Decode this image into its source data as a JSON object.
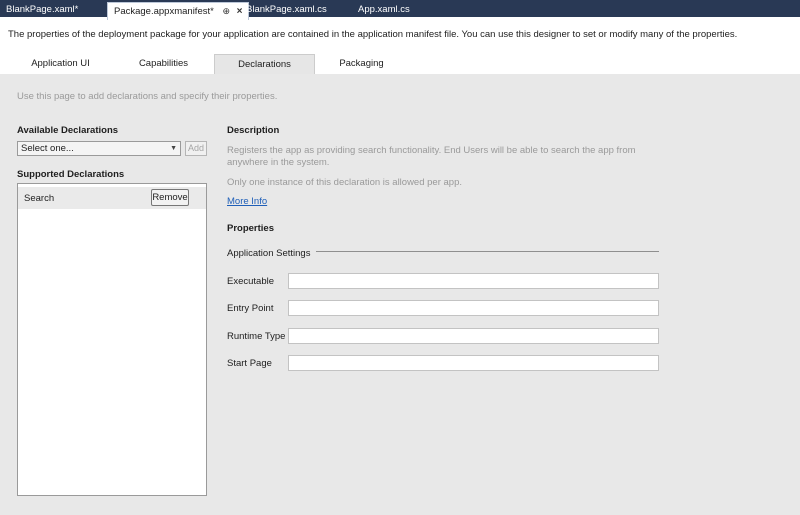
{
  "doc_tabs": [
    {
      "label": "BlankPage.xaml*"
    },
    {
      "label": "Package.appxmanifest*",
      "pin_glyph": "⊕",
      "close_glyph": "×"
    },
    {
      "label": "BlankPage.xaml.cs"
    },
    {
      "label": "App.xaml.cs"
    }
  ],
  "description": "The properties of the deployment package for your application are contained in the application manifest file. You can use this designer to set or modify many of the properties.",
  "designer_tabs": [
    {
      "label": "Application UI"
    },
    {
      "label": "Capabilities"
    },
    {
      "label": "Declarations"
    },
    {
      "label": "Packaging"
    }
  ],
  "hint": "Use this page to add declarations and specify their properties.",
  "available": {
    "title": "Available Declarations",
    "selected": "Select one...",
    "add_label": "Add"
  },
  "supported": {
    "title": "Supported Declarations",
    "items": [
      {
        "name": "Search",
        "remove_label": "Remove"
      }
    ]
  },
  "details": {
    "description_title": "Description",
    "description_line1": "Registers the app as providing search functionality. End Users will be able to search the app from",
    "description_line2": "anywhere in the system.",
    "note": "Only one instance of this declaration is allowed per app.",
    "more_info": "More Info",
    "properties_title": "Properties",
    "group_title": "Application Settings",
    "fields": [
      {
        "label": "Executable",
        "value": ""
      },
      {
        "label": "Entry Point",
        "value": ""
      },
      {
        "label": "Runtime Type",
        "value": ""
      },
      {
        "label": "Start Page",
        "value": ""
      }
    ]
  },
  "colors": {
    "tab_strip": "#293955",
    "content_bg": "#e8e8e8",
    "link": "#1f5fb8",
    "muted_text": "#9a9a9a"
  }
}
